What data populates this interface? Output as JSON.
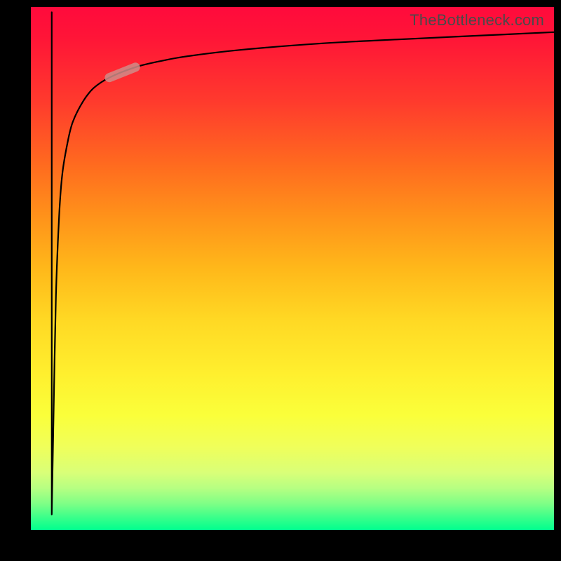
{
  "watermark": "TheBottleneck.com",
  "colors": {
    "frame": "#000000",
    "curve_stroke": "#000000",
    "highlight_stroke": "#d08c88"
  },
  "chart_data": {
    "type": "line",
    "title": "",
    "xlabel": "",
    "ylabel": "",
    "xlim": [
      0,
      100
    ],
    "ylim": [
      0,
      100
    ],
    "grid": false,
    "series": [
      {
        "name": "curve",
        "x": [
          4,
          4.3,
          4.8,
          5.4,
          6,
          7,
          8,
          10,
          12,
          15,
          20,
          25,
          30,
          40,
          55,
          70,
          85,
          100
        ],
        "y": [
          3,
          20,
          45,
          60,
          68,
          74,
          78,
          82,
          84.5,
          86.5,
          88.5,
          89.7,
          90.6,
          91.8,
          93,
          93.8,
          94.5,
          95.2
        ]
      }
    ],
    "highlight_segment": {
      "x": [
        15,
        20
      ],
      "y": [
        86.5,
        88.5
      ]
    },
    "note": "values estimated from unlabeled gradient plot; 0 = bottom/left edge, 100 = top/right edge of plot area"
  }
}
